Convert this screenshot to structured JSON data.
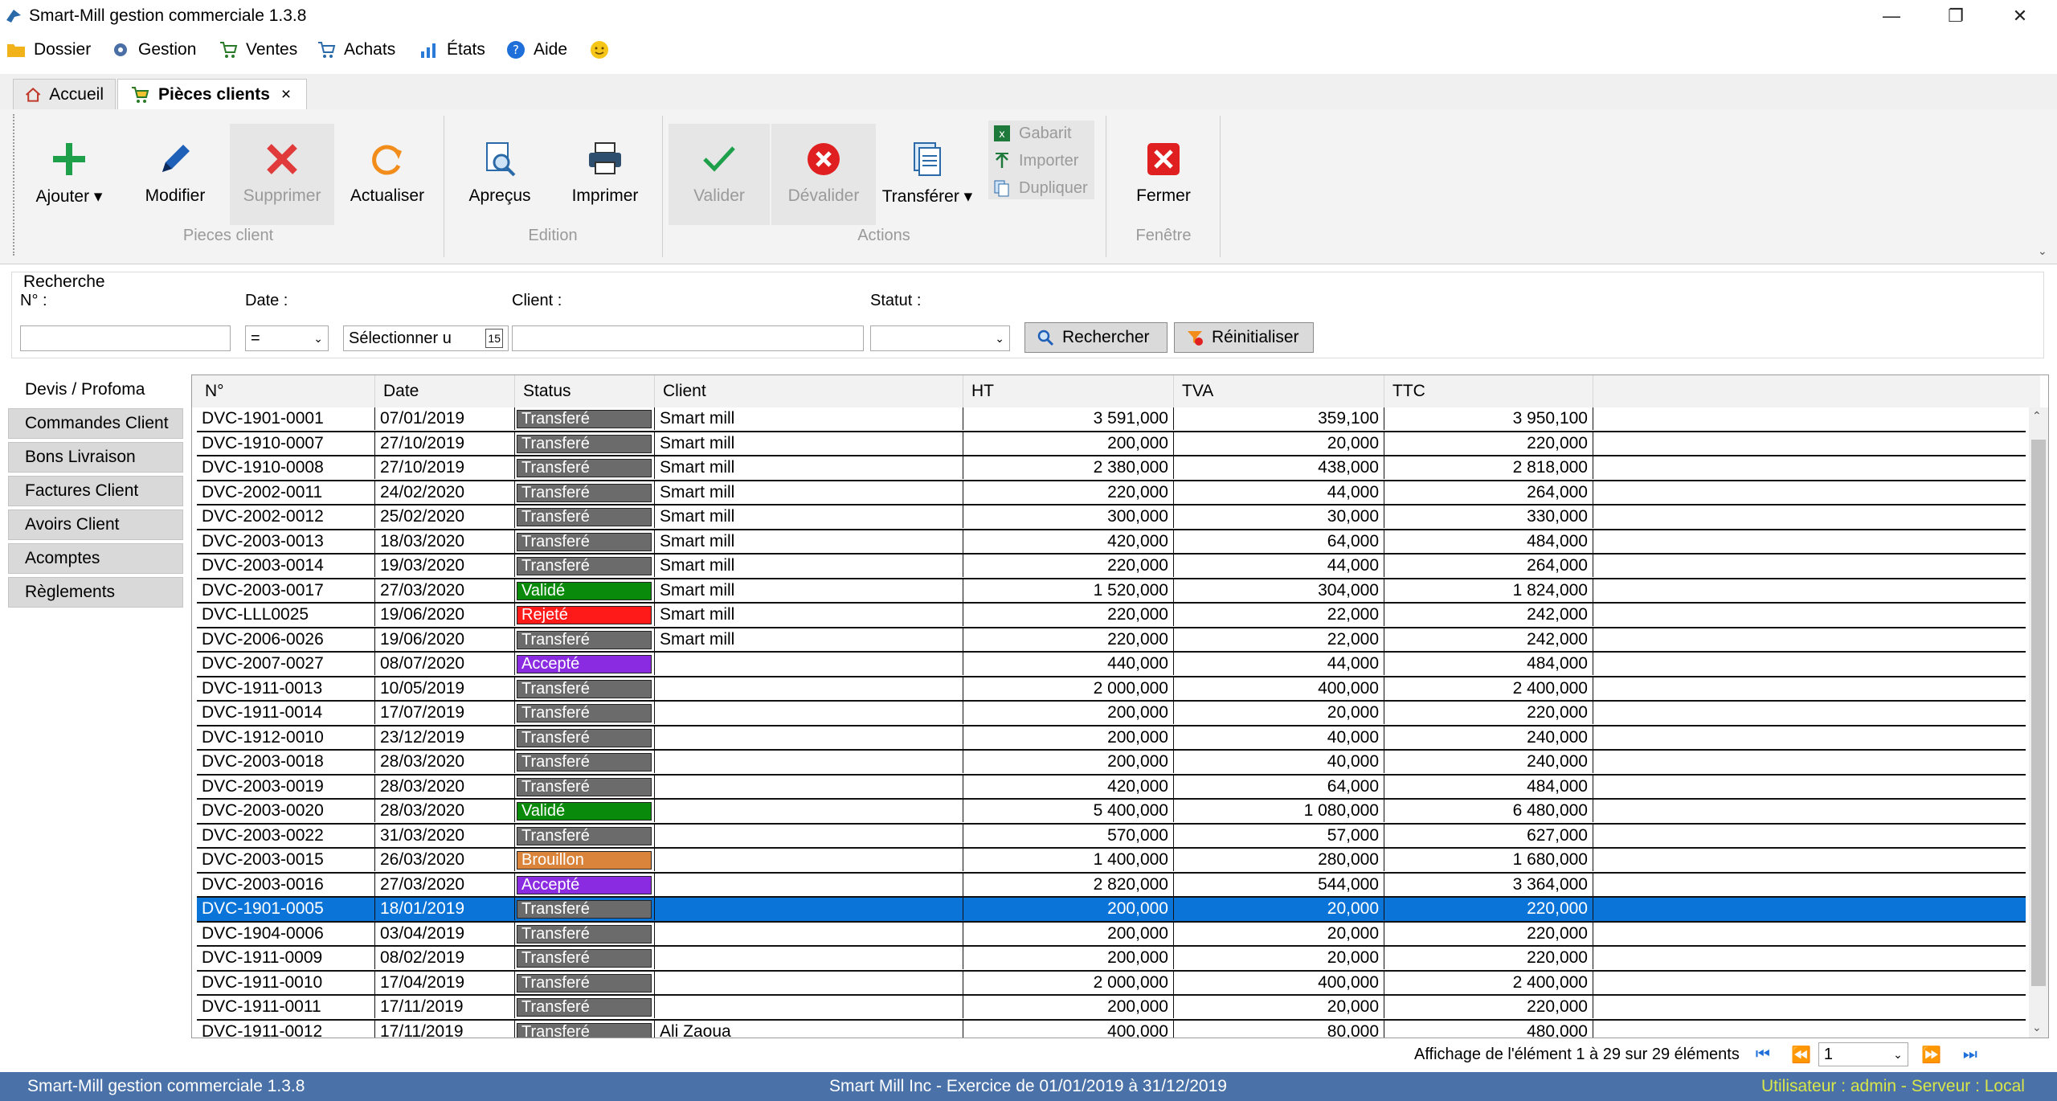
{
  "window": {
    "title": "Smart-Mill gestion commerciale 1.3.8"
  },
  "menu": [
    {
      "label": "Dossier",
      "icon": "folder-icon"
    },
    {
      "label": "Gestion",
      "icon": "gear-icon"
    },
    {
      "label": "Ventes",
      "icon": "cart-icon"
    },
    {
      "label": "Achats",
      "icon": "cart-icon"
    },
    {
      "label": "États",
      "icon": "chart-icon"
    },
    {
      "label": "Aide",
      "icon": "help-icon"
    },
    {
      "label": "",
      "icon": "smiley-icon"
    }
  ],
  "tabs": [
    {
      "label": "Accueil"
    },
    {
      "label": "Pièces clients",
      "close": "×"
    }
  ],
  "ribbon": {
    "groups": [
      {
        "label": "Pieces client",
        "buttons": [
          "Ajouter",
          "Modifier",
          "Supprimer",
          "Actualiser"
        ]
      },
      {
        "label": "Edition",
        "buttons": [
          "Apreçus",
          "Imprimer"
        ]
      },
      {
        "label": "Actions",
        "buttons": [
          "Valider",
          "Dévalider",
          "Transférer"
        ],
        "mini": [
          "Gabarit",
          "Importer",
          "Dupliquer"
        ]
      },
      {
        "label": "Fenêtre",
        "buttons": [
          "Fermer"
        ]
      }
    ]
  },
  "search": {
    "title": "Recherche",
    "num_label": "N° :",
    "date_label": "Date :",
    "date_operator": "=",
    "date_placeholder": "Sélectionner u",
    "calendar_day": "15",
    "client_label": "Client :",
    "status_label": "Statut :",
    "search_button": "Rechercher",
    "reset_button": "Réinitialiser"
  },
  "nav": [
    "Devis / Profoma",
    "Commandes Client",
    "Bons Livraison",
    "Factures Client",
    "Avoirs Client",
    "Acomptes",
    "Règlements"
  ],
  "grid": {
    "columns": [
      "N°",
      "Date",
      "Status",
      "Client",
      "HT",
      "TVA",
      "TTC"
    ],
    "rows": [
      {
        "num": "DVC-1901-0001",
        "date": "07/01/2019",
        "status": "Transferé",
        "client": "Smart mill",
        "ht": "3 591,000",
        "tva": "359,100",
        "ttc": "3 950,100"
      },
      {
        "num": "DVC-1910-0007",
        "date": "27/10/2019",
        "status": "Transferé",
        "client": "Smart mill",
        "ht": "200,000",
        "tva": "20,000",
        "ttc": "220,000"
      },
      {
        "num": "DVC-1910-0008",
        "date": "27/10/2019",
        "status": "Transferé",
        "client": "Smart mill",
        "ht": "2 380,000",
        "tva": "438,000",
        "ttc": "2 818,000"
      },
      {
        "num": "DVC-2002-0011",
        "date": "24/02/2020",
        "status": "Transferé",
        "client": "Smart mill",
        "ht": "220,000",
        "tva": "44,000",
        "ttc": "264,000"
      },
      {
        "num": "DVC-2002-0012",
        "date": "25/02/2020",
        "status": "Transferé",
        "client": "Smart mill",
        "ht": "300,000",
        "tva": "30,000",
        "ttc": "330,000"
      },
      {
        "num": "DVC-2003-0013",
        "date": "18/03/2020",
        "status": "Transferé",
        "client": "Smart mill",
        "ht": "420,000",
        "tva": "64,000",
        "ttc": "484,000"
      },
      {
        "num": "DVC-2003-0014",
        "date": "19/03/2020",
        "status": "Transferé",
        "client": "Smart mill",
        "ht": "220,000",
        "tva": "44,000",
        "ttc": "264,000"
      },
      {
        "num": "DVC-2003-0017",
        "date": "27/03/2020",
        "status": "Validé",
        "client": "Smart mill",
        "ht": "1 520,000",
        "tva": "304,000",
        "ttc": "1 824,000"
      },
      {
        "num": "DVC-LLL0025",
        "date": "19/06/2020",
        "status": "Rejeté",
        "client": "Smart mill",
        "ht": "220,000",
        "tva": "22,000",
        "ttc": "242,000"
      },
      {
        "num": "DVC-2006-0026",
        "date": "19/06/2020",
        "status": "Transferé",
        "client": "Smart mill",
        "ht": "220,000",
        "tva": "22,000",
        "ttc": "242,000"
      },
      {
        "num": "DVC-2007-0027",
        "date": "08/07/2020",
        "status": "Accepté",
        "client": "",
        "ht": "440,000",
        "tva": "44,000",
        "ttc": "484,000"
      },
      {
        "num": "DVC-1911-0013",
        "date": "10/05/2019",
        "status": "Transferé",
        "client": "",
        "ht": "2 000,000",
        "tva": "400,000",
        "ttc": "2 400,000"
      },
      {
        "num": "DVC-1911-0014",
        "date": "17/07/2019",
        "status": "Transferé",
        "client": "",
        "ht": "200,000",
        "tva": "20,000",
        "ttc": "220,000"
      },
      {
        "num": "DVC-1912-0010",
        "date": "23/12/2019",
        "status": "Transferé",
        "client": "",
        "ht": "200,000",
        "tva": "40,000",
        "ttc": "240,000"
      },
      {
        "num": "DVC-2003-0018",
        "date": "28/03/2020",
        "status": "Transferé",
        "client": "",
        "ht": "200,000",
        "tva": "40,000",
        "ttc": "240,000"
      },
      {
        "num": "DVC-2003-0019",
        "date": "28/03/2020",
        "status": "Transferé",
        "client": "",
        "ht": "420,000",
        "tva": "64,000",
        "ttc": "484,000"
      },
      {
        "num": "DVC-2003-0020",
        "date": "28/03/2020",
        "status": "Validé",
        "client": "",
        "ht": "5 400,000",
        "tva": "1 080,000",
        "ttc": "6 480,000"
      },
      {
        "num": "DVC-2003-0022",
        "date": "31/03/2020",
        "status": "Transferé",
        "client": "",
        "ht": "570,000",
        "tva": "57,000",
        "ttc": "627,000"
      },
      {
        "num": "DVC-2003-0015",
        "date": "26/03/2020",
        "status": "Brouillon",
        "client": "",
        "ht": "1 400,000",
        "tva": "280,000",
        "ttc": "1 680,000"
      },
      {
        "num": "DVC-2003-0016",
        "date": "27/03/2020",
        "status": "Accepté",
        "client": "",
        "ht": "2 820,000",
        "tva": "544,000",
        "ttc": "3 364,000"
      },
      {
        "num": "DVC-1901-0005",
        "date": "18/01/2019",
        "status": "Transferé",
        "client": "",
        "ht": "200,000",
        "tva": "20,000",
        "ttc": "220,000",
        "selected": true
      },
      {
        "num": "DVC-1904-0006",
        "date": "03/04/2019",
        "status": "Transferé",
        "client": "",
        "ht": "200,000",
        "tva": "20,000",
        "ttc": "220,000"
      },
      {
        "num": "DVC-1911-0009",
        "date": "08/02/2019",
        "status": "Transferé",
        "client": "",
        "ht": "200,000",
        "tva": "20,000",
        "ttc": "220,000"
      },
      {
        "num": "DVC-1911-0010",
        "date": "17/04/2019",
        "status": "Transferé",
        "client": "",
        "ht": "2 000,000",
        "tva": "400,000",
        "ttc": "2 400,000"
      },
      {
        "num": "DVC-1911-0011",
        "date": "17/11/2019",
        "status": "Transferé",
        "client": "",
        "ht": "200,000",
        "tva": "20,000",
        "ttc": "220,000"
      },
      {
        "num": "DVC-1911-0012",
        "date": "17/11/2019",
        "status": "Transferé",
        "client": "Ali Zaoua",
        "ht": "400,000",
        "tva": "80,000",
        "ttc": "480,000"
      }
    ],
    "status_colors": {
      "Transferé": "#6b6b6b",
      "Validé": "#0a8a0a",
      "Rejeté": "#ff1a1a",
      "Accepté": "#8a2be2",
      "Brouillon": "#d9843a"
    }
  },
  "pager": {
    "info": "Affichage de l'élément 1 à 29 sur 29 éléments",
    "page": "1"
  },
  "status": {
    "left": "Smart-Mill gestion commerciale 1.3.8",
    "center": "Smart Mill Inc - Exercice de 01/01/2019 à 31/12/2019",
    "right": "Utilisateur : admin - Serveur : Local"
  },
  "colors": {
    "statusbar_bg": "#4a72a8",
    "statusbar_right": "#d8e64a",
    "selection": "#0a74d8"
  }
}
